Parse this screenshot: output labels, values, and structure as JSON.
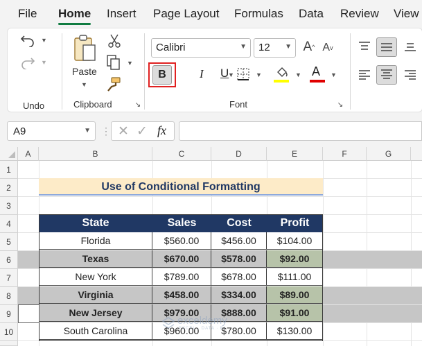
{
  "menu": {
    "items": [
      "File",
      "Home",
      "Insert",
      "Page Layout",
      "Formulas",
      "Data",
      "Review",
      "View"
    ],
    "active": "Home"
  },
  "ribbon": {
    "undo": {
      "group_label": "Undo"
    },
    "clipboard": {
      "paste_label": "Paste",
      "group_label": "Clipboard"
    },
    "font": {
      "font_name": "Calibri",
      "font_size": "12",
      "bold_label": "B",
      "italic_label": "I",
      "underline_label": "U",
      "font_color_label": "A",
      "group_label": "Font",
      "highlight_color": "#ffff00",
      "font_color": "#e00000",
      "bold_highlight_color": "#e02020"
    }
  },
  "formula_bar": {
    "name_box": "A9",
    "fx_label": "fx",
    "formula": ""
  },
  "columns": [
    "A",
    "B",
    "C",
    "D",
    "E",
    "F",
    "G"
  ],
  "rows": [
    "1",
    "2",
    "3",
    "4",
    "5",
    "6",
    "7",
    "8",
    "9",
    "10"
  ],
  "sheet": {
    "title": "Use of Conditional Formatting",
    "headers": [
      "State",
      "Sales",
      "Cost",
      "Profit"
    ],
    "data": [
      {
        "state": "Florida",
        "sales": "$560.00",
        "cost": "$456.00",
        "profit": "$104.00",
        "bold": false
      },
      {
        "state": "Texas",
        "sales": "$670.00",
        "cost": "$578.00",
        "profit": "$92.00",
        "bold": true
      },
      {
        "state": "New York",
        "sales": "$789.00",
        "cost": "$678.00",
        "profit": "$111.00",
        "bold": false
      },
      {
        "state": "Virginia",
        "sales": "$458.00",
        "cost": "$334.00",
        "profit": "$89.00",
        "bold": true
      },
      {
        "state": "New Jersey",
        "sales": "$979.00",
        "cost": "$888.00",
        "profit": "$91.00",
        "bold": true
      },
      {
        "state": "South Carolina",
        "sales": "$960.00",
        "cost": "$780.00",
        "profit": "$130.00",
        "bold": false
      }
    ]
  },
  "watermark": {
    "name": "exceldemy",
    "tagline": "EXCEL · DATA · BI"
  },
  "colors": {
    "accent": "#107c41",
    "header_fill": "#203864",
    "title_fill": "#fdebc8",
    "band_fill": "#c6c6c6",
    "profit_fill": "#b7c3a9"
  }
}
